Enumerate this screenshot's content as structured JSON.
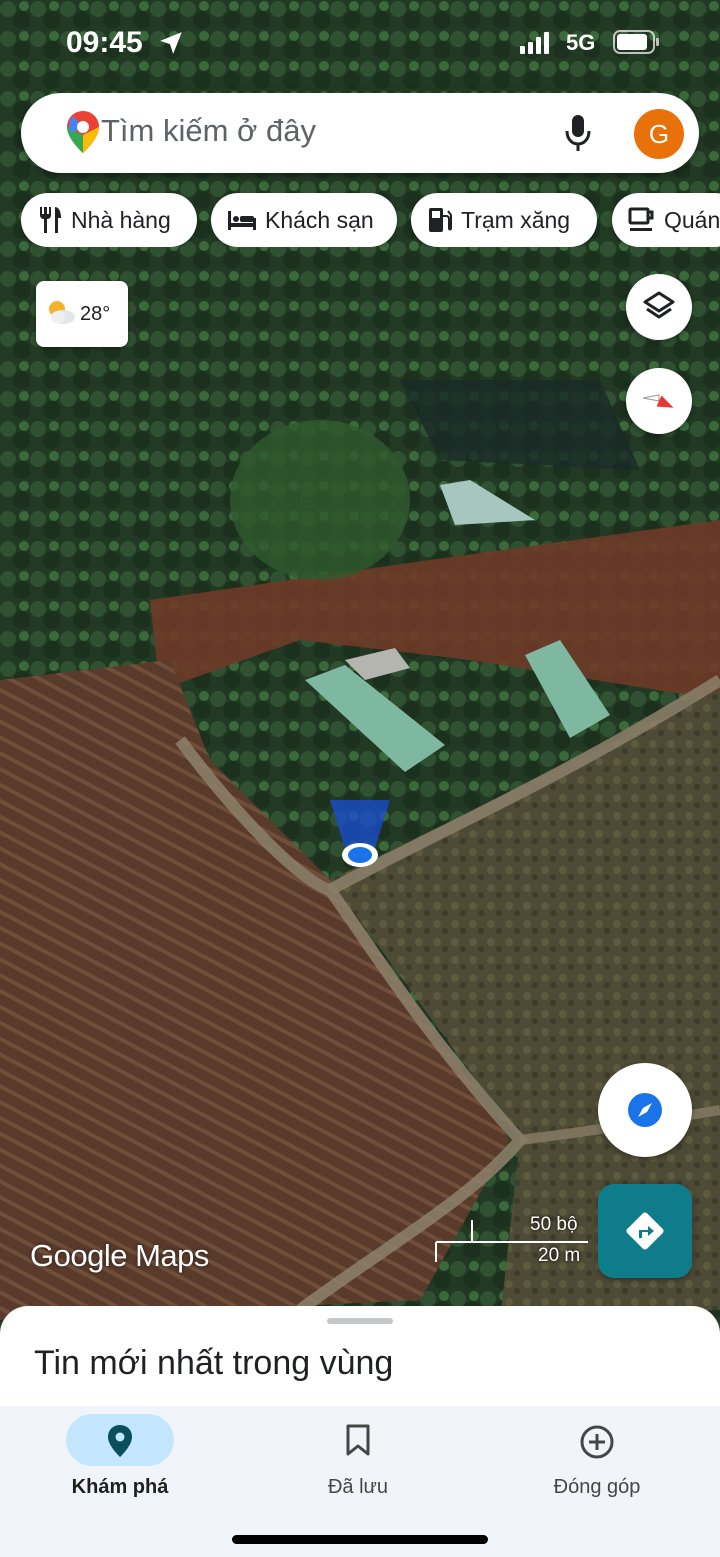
{
  "status": {
    "time": "09:45",
    "network": "5G"
  },
  "search": {
    "placeholder": "Tìm kiếm ở đây",
    "avatar_letter": "G"
  },
  "chips": [
    {
      "label": "Nhà hàng",
      "icon": "restaurant-icon"
    },
    {
      "label": "Khách sạn",
      "icon": "hotel-icon"
    },
    {
      "label": "Trạm xăng",
      "icon": "gas-station-icon"
    },
    {
      "label": "Quán",
      "icon": "coffee-icon"
    }
  ],
  "weather": {
    "temperature": "28°",
    "icon": "partly-cloudy-icon"
  },
  "map": {
    "logo": "Google Maps",
    "scale_imperial": "50 bộ",
    "scale_metric": "20 m"
  },
  "sheet": {
    "title": "Tin mới nhất trong vùng"
  },
  "nav": {
    "items": [
      {
        "label": "Khám phá",
        "icon": "explore-pin-icon",
        "active": true
      },
      {
        "label": "Đã lưu",
        "icon": "bookmark-icon",
        "active": false
      },
      {
        "label": "Đóng góp",
        "icon": "add-circle-icon",
        "active": false
      }
    ]
  },
  "colors": {
    "accent": "#1a73e8",
    "directions": "#0f7c8c",
    "nav_active": "#c2e7ff",
    "avatar": "#e8710a"
  }
}
